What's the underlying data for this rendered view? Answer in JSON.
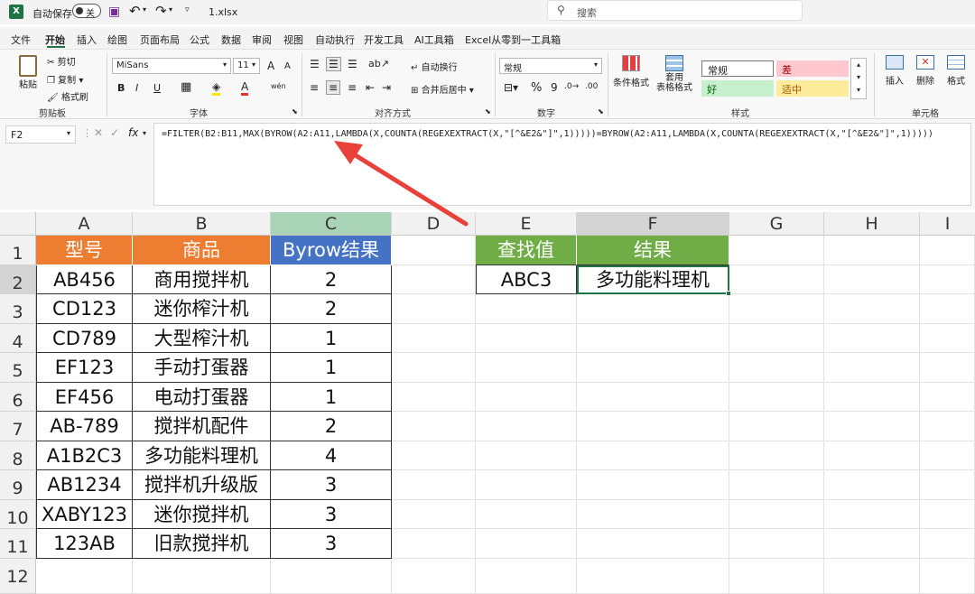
{
  "title_bar": {
    "autosave_label": "自动保存",
    "autosave_state": "关",
    "filename": "1.xlsx",
    "search_placeholder": "搜索"
  },
  "tabs": [
    "文件",
    "开始",
    "插入",
    "绘图",
    "页面布局",
    "公式",
    "数据",
    "审阅",
    "视图",
    "自动执行",
    "开发工具",
    "AI工具箱",
    "Excel从零到一工具箱"
  ],
  "active_tab": "开始",
  "ribbon": {
    "clipboard": {
      "paste": "粘贴",
      "cut": "剪切",
      "copy": "复制",
      "format_painter": "格式刷",
      "label": "剪贴板"
    },
    "font": {
      "name": "MiSans",
      "size": "11",
      "label": "字体",
      "bold": "B",
      "italic": "I",
      "underline": "U",
      "grow": "A",
      "shrink": "A",
      "font_color": "A",
      "wen": "wén"
    },
    "alignment": {
      "wrap": "自动换行",
      "merge": "合并后居中",
      "label": "对齐方式"
    },
    "number": {
      "format": "常规",
      "label": "数字",
      "percent": "%",
      "comma": "9"
    },
    "styles": {
      "conditional": "条件格式",
      "table": "套用\n表格格式",
      "normal": "常规",
      "bad": "差",
      "good": "好",
      "neutral": "适中",
      "label": "样式"
    },
    "cells": {
      "insert": "插入",
      "delete": "删除",
      "format": "格式",
      "label": "单元格"
    }
  },
  "formula_bar": {
    "name_box": "F2",
    "fx": "fx",
    "formula": "=FILTER(B2:B11,MAX(BYROW(A2:A11,LAMBDA(X,COUNTA(REGEXEXTRACT(X,\"[^&E2&\"]\",1)))))=BYROW(A2:A11,LAMBDA(X,COUNTA(REGEXEXTRACT(X,\"[^&E2&\"]\",1)))))"
  },
  "columns": [
    "A",
    "B",
    "C",
    "D",
    "E",
    "F",
    "G",
    "H",
    "I"
  ],
  "rows": [
    "1",
    "2",
    "3",
    "4",
    "5",
    "6",
    "7",
    "8",
    "9",
    "10",
    "11",
    "12"
  ],
  "table": {
    "headers": [
      "型号",
      "商品",
      "Byrow结果"
    ],
    "rows": [
      [
        "AB456",
        "商用搅拌机",
        "2"
      ],
      [
        "CD123",
        "迷你榨汁机",
        "2"
      ],
      [
        "CD789",
        "大型榨汁机",
        "1"
      ],
      [
        "EF123",
        "手动打蛋器",
        "1"
      ],
      [
        "EF456",
        "电动打蛋器",
        "1"
      ],
      [
        "AB-789",
        "搅拌机配件",
        "2"
      ],
      [
        "A1B2C3",
        "多功能料理机",
        "4"
      ],
      [
        "AB1234",
        "搅拌机升级版",
        "3"
      ],
      [
        "XABY123",
        "迷你搅拌机",
        "3"
      ],
      [
        "123AB",
        "旧款搅拌机",
        "3"
      ]
    ]
  },
  "lookup": {
    "header_e": "查找值",
    "header_f": "结果",
    "value_e": "ABC3",
    "value_f": "多功能料理机"
  },
  "colors": {
    "orange": "#ED7D31",
    "blue": "#4472C4",
    "green": "#70AD47",
    "excel_green": "#217346",
    "arrow_red": "#E8413A"
  }
}
